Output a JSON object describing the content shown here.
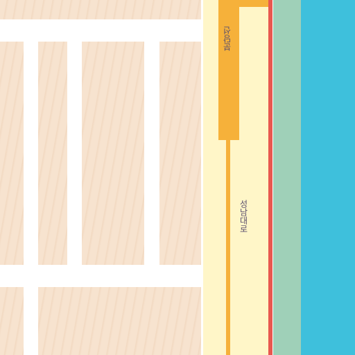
{
  "map": {
    "colors": {
      "land": "#f7e3cf",
      "land_grain": "#f2d9c1",
      "street": "#ffffff",
      "road": "#fff6c8",
      "road_border": "#ffffff",
      "route_orange": "#f6b13a",
      "route_red": "#e8584f",
      "green_strip": "#9fd0b8",
      "river": "#3ec0dc",
      "label_text": "#5a4f6e"
    },
    "labels": {
      "road_label_orange": "분당선",
      "road_label_main": "성남대로"
    }
  }
}
